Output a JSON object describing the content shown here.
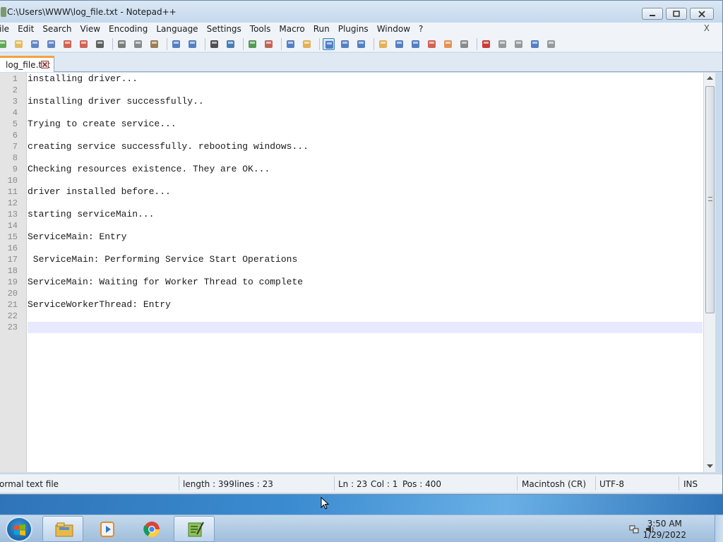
{
  "window": {
    "title": "C:\\Users\\WWW\\log_file.txt - Notepad++"
  },
  "menu": {
    "items": [
      "ile",
      "Edit",
      "Search",
      "View",
      "Encoding",
      "Language",
      "Settings",
      "Tools",
      "Macro",
      "Run",
      "Plugins",
      "Window",
      "?"
    ],
    "close_label": "X"
  },
  "tabs": [
    {
      "label": "log_file.txt"
    }
  ],
  "editor": {
    "line_numbers": [
      "1",
      "2",
      "3",
      "4",
      "5",
      "6",
      "7",
      "8",
      "9",
      "10",
      "11",
      "12",
      "13",
      "14",
      "15",
      "16",
      "17",
      "18",
      "19",
      "20",
      "21",
      "22",
      "23"
    ],
    "lines": [
      "installing driver...",
      "",
      "installing driver successfully..",
      "",
      "Trying to create service...",
      "",
      "creating service successfully. rebooting windows...",
      "",
      "Checking resources existence. They are OK...",
      "",
      "driver installed before...",
      "",
      "starting serviceMain...",
      "",
      "ServiceMain: Entry",
      "",
      " ServiceMain: Performing Service Start Operations",
      "",
      "ServiceMain: Waiting for Worker Thread to complete",
      "",
      "ServiceWorkerThread: Entry",
      "",
      ""
    ]
  },
  "status": {
    "file_type": "ormal text file",
    "length": "length : 399",
    "lines": "lines : 23",
    "ln": "Ln : 23",
    "col": "Col : 1",
    "pos": "Pos : 400",
    "eol": "Macintosh (CR)",
    "encoding": "UTF-8",
    "mode": "INS"
  },
  "taskbar": {
    "time": "3:50 AM",
    "date": "1/29/2022",
    "apps": [
      "file-explorer-icon",
      "media-player-icon",
      "chrome-icon",
      "notepad-plus-plus-icon"
    ]
  },
  "colors": {
    "tab_accent": "#f6a13a",
    "current_line": "#e8e8ff",
    "gutter": "#e4e4e4"
  }
}
